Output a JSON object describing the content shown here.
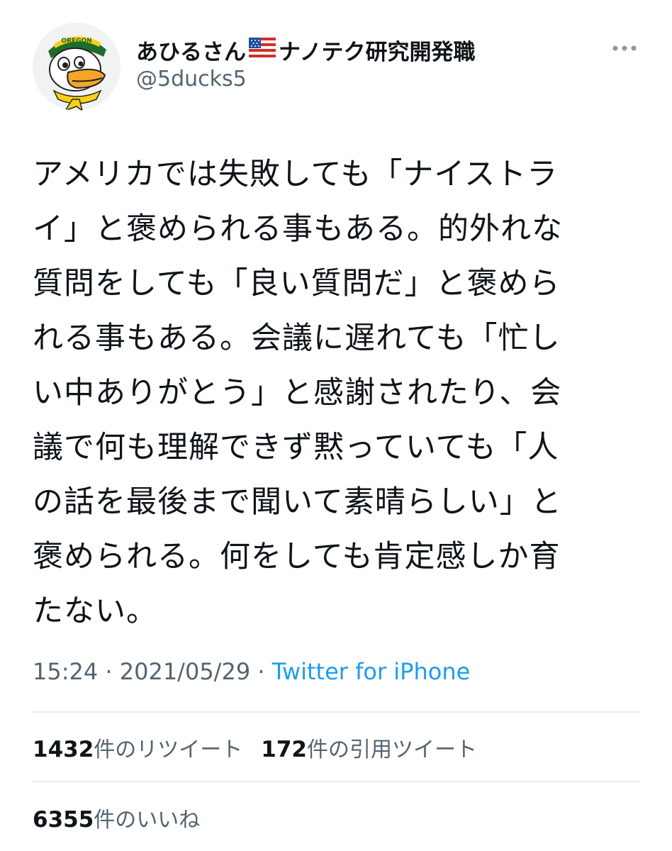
{
  "author": {
    "display_name_part1": "あひるさん",
    "flag_icon": "us-flag-icon",
    "display_name_part2": "ナノテク研究開発職",
    "handle": "@5ducks5",
    "avatar_icon": "duck-mascot-avatar",
    "avatar_cap_text": "OREGON"
  },
  "menu": {
    "more_icon": "more-horizontal-icon"
  },
  "tweet": {
    "text": "アメリカでは失敗しても「ナイストラ\nイ」と褒められる事もある。的外れな\n質問をしても「良い質問だ」と褒めら\nれる事もある。会議に遅れても「忙し\nい中ありがとう」と感謝されたり、会\n議で何も理解できず黙っていても「人\nの話を最後まで聞いて素晴らしい」と\n褒められる。何をしても肯定感しか育\nたない。",
    "time": "15:24",
    "separator1": " · ",
    "date": "2021/05/29",
    "separator2": " · ",
    "source": "Twitter for iPhone"
  },
  "stats": {
    "retweets_count": "1432",
    "retweets_label": "件のリツイート",
    "quotes_count": "172",
    "quotes_label": "件の引用ツイート",
    "likes_count": "6355",
    "likes_label": "件のいいね"
  },
  "colors": {
    "text": "#0f1419",
    "secondary": "#536471",
    "link": "#1d9bf0",
    "divider": "#e8ecee"
  }
}
